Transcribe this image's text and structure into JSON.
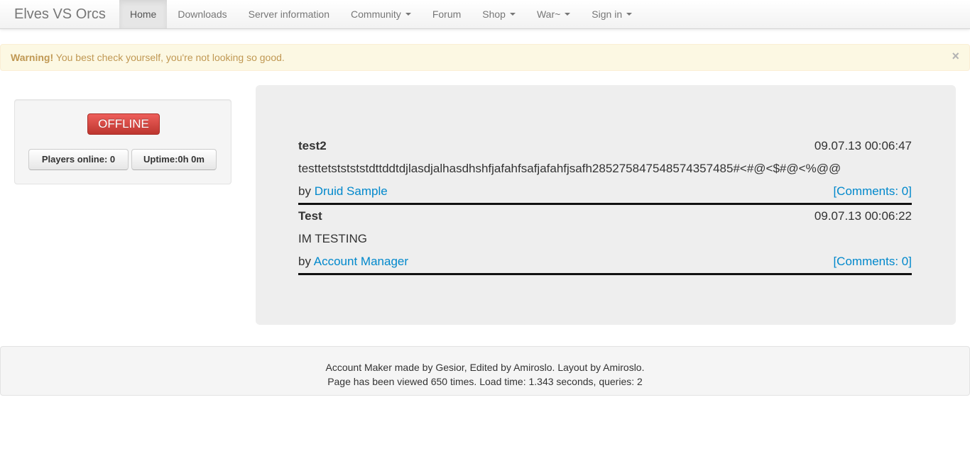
{
  "navbar": {
    "brand": "Elves VS Orcs",
    "items": [
      {
        "label": "Home",
        "active": true,
        "dropdown": false
      },
      {
        "label": "Downloads",
        "active": false,
        "dropdown": false
      },
      {
        "label": "Server information",
        "active": false,
        "dropdown": false
      },
      {
        "label": "Community",
        "active": false,
        "dropdown": true
      },
      {
        "label": "Forum",
        "active": false,
        "dropdown": false
      },
      {
        "label": "Shop",
        "active": false,
        "dropdown": true
      },
      {
        "label": "War~",
        "active": false,
        "dropdown": true
      },
      {
        "label": "Sign in",
        "active": false,
        "dropdown": true
      }
    ]
  },
  "alert": {
    "strong": "Warning!",
    "message": "You best check yourself, you're not looking so good.",
    "close": "×"
  },
  "status": {
    "server_state": "OFFLINE",
    "players_online": "Players online: 0",
    "uptime": "Uptime:0h 0m"
  },
  "news": [
    {
      "title": "test2",
      "date": "09.07.13 00:06:47",
      "body": "testtetststststdttddtdjlasdjalhasdhshfjafahfsafjafahfjsafh285275847548574357485#<#@<$#@<%@@",
      "by_prefix": "by",
      "author": "Druid Sample",
      "comments": "[Comments: 0]"
    },
    {
      "title": "Test",
      "date": "09.07.13 00:06:22",
      "body": "IM TESTING",
      "by_prefix": "by",
      "author": "Account Manager",
      "comments": "[Comments: 0]"
    }
  ],
  "footer": {
    "line1": "Account Maker made by Gesior, Edited by Amiroslo. Layout by Amiroslo.",
    "line2": "Page has been viewed 650 times. Load time: 1.343 seconds, queries: 2"
  },
  "colors": {
    "link": "#0088cc",
    "danger": "#da4f49",
    "warning_bg": "#fcf8e3",
    "warning_text": "#c09853"
  }
}
